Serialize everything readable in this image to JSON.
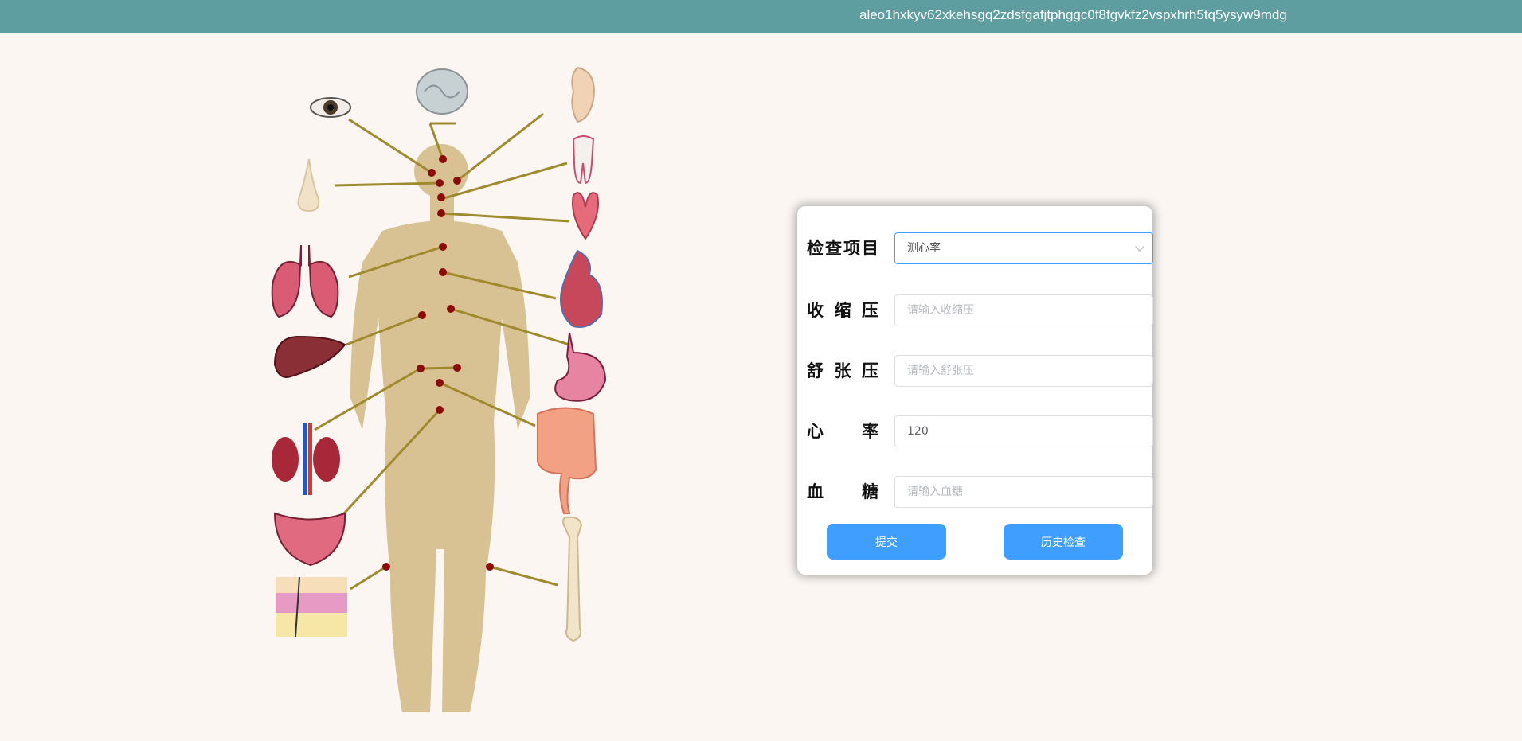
{
  "header": {
    "wallet_address": "aleo1hxkyv62xkehsgq2zdsfgafjtphggc0f8fgvkfz2vspxhrh5tq5ysyw9mdg",
    "background_color": "#5f9ea0"
  },
  "body_map": {
    "organ_icons_left": [
      "eye-icon",
      "nose-icon",
      "lungs-icon",
      "liver-icon",
      "kidneys-icon",
      "bladder-icon",
      "skin-icon"
    ],
    "organ_icons_center": [
      "brain-icon"
    ],
    "organ_icons_right": [
      "ear-icon",
      "tooth-icon",
      "thyroid-icon",
      "heart-icon",
      "stomach-icon",
      "intestines-icon",
      "bone-icon"
    ]
  },
  "form": {
    "exam_item": {
      "label": "检查项目",
      "selected": "测心率"
    },
    "systolic": {
      "label": "收缩压",
      "value": "",
      "placeholder": "请输入收缩压"
    },
    "diastolic": {
      "label": "舒张压",
      "value": "",
      "placeholder": "请输入舒张压"
    },
    "heart_rate": {
      "label": "心率",
      "value": "120",
      "placeholder": ""
    },
    "blood_sugar": {
      "label": "血糖",
      "value": "",
      "placeholder": "请输入血糖"
    },
    "submit_label": "提交",
    "history_label": "历史检查",
    "accent_color": "#409eff"
  }
}
